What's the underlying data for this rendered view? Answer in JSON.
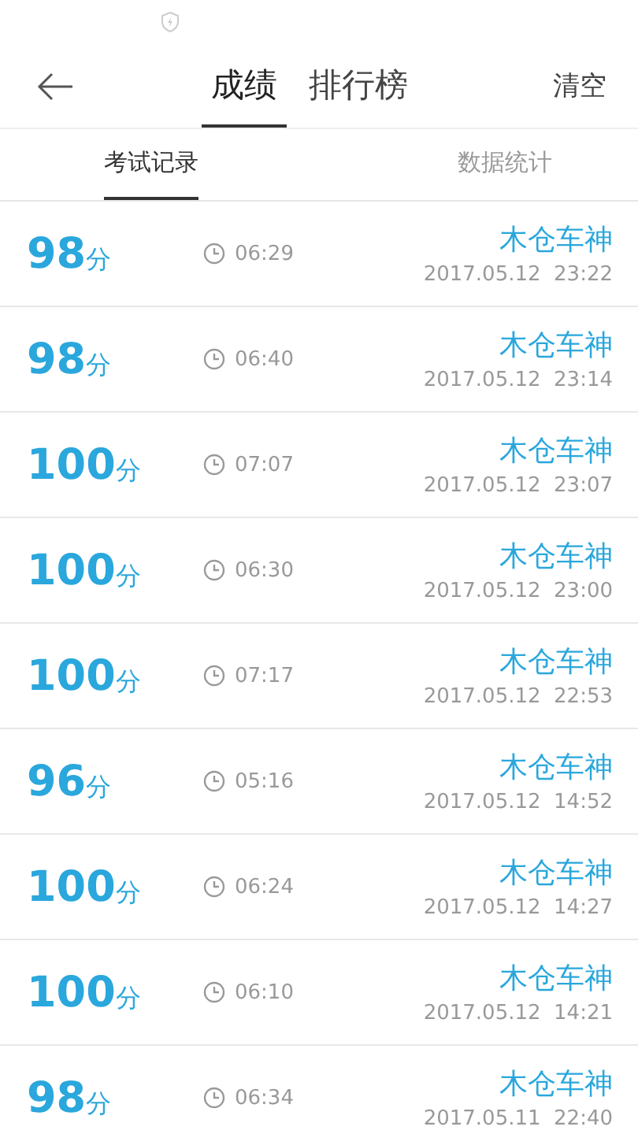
{
  "header": {
    "tabs": [
      {
        "label": "成绩",
        "selected": true
      },
      {
        "label": "排行榜",
        "selected": false
      }
    ],
    "action": "清空"
  },
  "subtabs": [
    {
      "label": "考试记录",
      "selected": true
    },
    {
      "label": "数据统计",
      "selected": false
    }
  ],
  "records": [
    {
      "score": "98",
      "unit": "分",
      "duration": "06:29",
      "name": "木仓车神",
      "date": "2017.05.12  23:22"
    },
    {
      "score": "98",
      "unit": "分",
      "duration": "06:40",
      "name": "木仓车神",
      "date": "2017.05.12  23:14"
    },
    {
      "score": "100",
      "unit": "分",
      "duration": "07:07",
      "name": "木仓车神",
      "date": "2017.05.12  23:07"
    },
    {
      "score": "100",
      "unit": "分",
      "duration": "06:30",
      "name": "木仓车神",
      "date": "2017.05.12  23:00"
    },
    {
      "score": "100",
      "unit": "分",
      "duration": "07:17",
      "name": "木仓车神",
      "date": "2017.05.12  22:53"
    },
    {
      "score": "96",
      "unit": "分",
      "duration": "05:16",
      "name": "木仓车神",
      "date": "2017.05.12  14:52"
    },
    {
      "score": "100",
      "unit": "分",
      "duration": "06:24",
      "name": "木仓车神",
      "date": "2017.05.12  14:27"
    },
    {
      "score": "100",
      "unit": "分",
      "duration": "06:10",
      "name": "木仓车神",
      "date": "2017.05.12  14:21"
    },
    {
      "score": "98",
      "unit": "分",
      "duration": "06:34",
      "name": "木仓车神",
      "date": "2017.05.11  22:40"
    }
  ]
}
